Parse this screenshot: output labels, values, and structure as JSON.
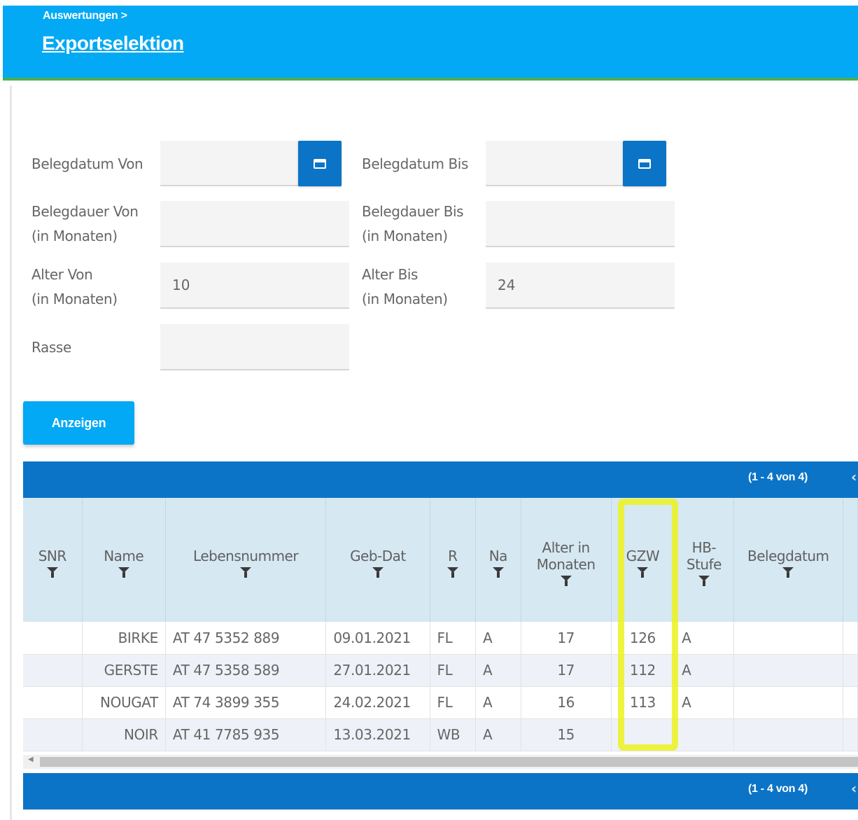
{
  "header": {
    "breadcrumb": "Auswertungen >",
    "title": "Exportselektion"
  },
  "form": {
    "belegdatum_von": {
      "label": "Belegdatum Von",
      "value": ""
    },
    "belegdatum_bis": {
      "label": "Belegdatum Bis",
      "value": ""
    },
    "belegdauer_von": {
      "label_line1": "Belegdauer Von",
      "label_line2": "(in Monaten)",
      "value": ""
    },
    "belegdauer_bis": {
      "label_line1": "Belegdauer Bis",
      "label_line2": "(in Monaten)",
      "value": ""
    },
    "alter_von": {
      "label_line1": "Alter Von",
      "label_line2": "(in Monaten)",
      "value": "10"
    },
    "alter_bis": {
      "label_line1": "Alter Bis",
      "label_line2": "(in Monaten)",
      "value": "24"
    },
    "rasse": {
      "label": "Rasse",
      "value": ""
    },
    "show_button": "Anzeigen"
  },
  "table": {
    "pager_text": "(1 - 4 von 4)",
    "columns": [
      {
        "line1": "SNR",
        "line2": ""
      },
      {
        "line1": "Name",
        "line2": ""
      },
      {
        "line1": "Lebensnummer",
        "line2": ""
      },
      {
        "line1": "Geb-Dat",
        "line2": ""
      },
      {
        "line1": "R",
        "line2": ""
      },
      {
        "line1": "Na",
        "line2": ""
      },
      {
        "line1": "Alter in",
        "line2": "Monaten"
      },
      {
        "line1": "GZW",
        "line2": ""
      },
      {
        "line1": "HB-",
        "line2": "Stufe"
      },
      {
        "line1": "Belegdatum",
        "line2": ""
      }
    ],
    "rows": [
      {
        "snr": "",
        "name": "BIRKE",
        "lebensnummer": "AT 47 5352 889",
        "geb_dat": "09.01.2021",
        "r": "FL",
        "na": "A",
        "alter": "17",
        "gzw": "126",
        "hb_stufe": "A",
        "belegdatum": ""
      },
      {
        "snr": "",
        "name": "GERSTE",
        "lebensnummer": "AT 47 5358 589",
        "geb_dat": "27.01.2021",
        "r": "FL",
        "na": "A",
        "alter": "17",
        "gzw": "112",
        "hb_stufe": "A",
        "belegdatum": ""
      },
      {
        "snr": "",
        "name": "NOUGAT",
        "lebensnummer": "AT 74 3899 355",
        "geb_dat": "24.02.2021",
        "r": "FL",
        "na": "A",
        "alter": "16",
        "gzw": "113",
        "hb_stufe": "A",
        "belegdatum": ""
      },
      {
        "snr": "",
        "name": "NOIR",
        "lebensnummer": "AT 41 7785 935",
        "geb_dat": "13.03.2021",
        "r": "WB",
        "na": "A",
        "alter": "15",
        "gzw": "",
        "hb_stufe": "",
        "belegdatum": ""
      }
    ]
  },
  "colors": {
    "header_bg": "#03a9f4",
    "header_border": "#4caf50",
    "primary_dark": "#0b74c7",
    "link": "#2a7fc1",
    "highlight": "#ecf21e"
  }
}
